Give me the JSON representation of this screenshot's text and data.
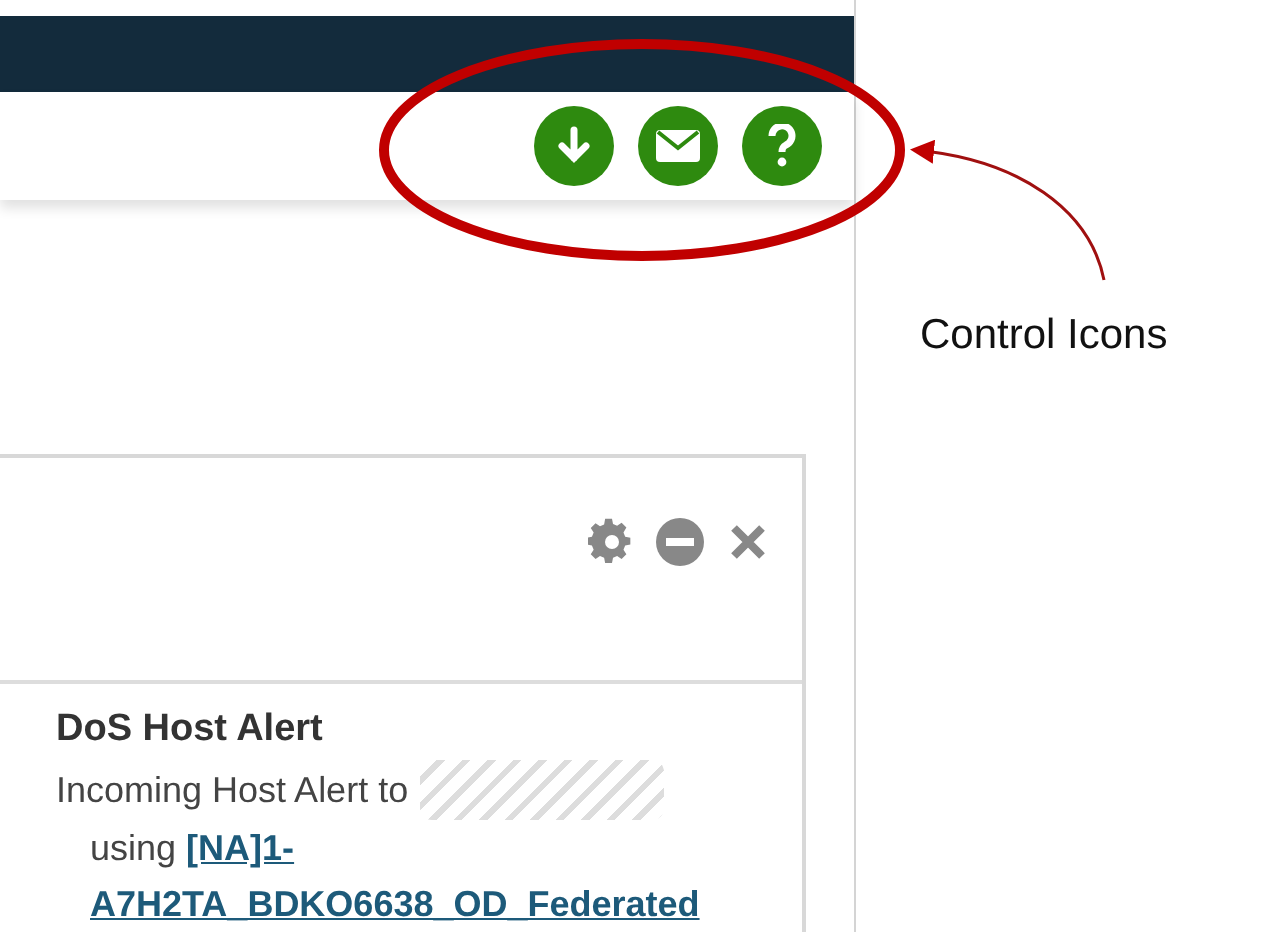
{
  "control_icons": [
    {
      "kind": "download"
    },
    {
      "kind": "mail"
    },
    {
      "kind": "help"
    }
  ],
  "annotation": {
    "label": "Control Icons"
  },
  "widget": {
    "tools": [
      {
        "kind": "settings"
      },
      {
        "kind": "minimize"
      },
      {
        "kind": "close"
      }
    ],
    "alert": {
      "title": "DoS Host Alert",
      "text": "Incoming Host Alert to",
      "using": "using",
      "link": "[NA]1-A7H2TA_BDKO6638_OD_Federated"
    }
  }
}
